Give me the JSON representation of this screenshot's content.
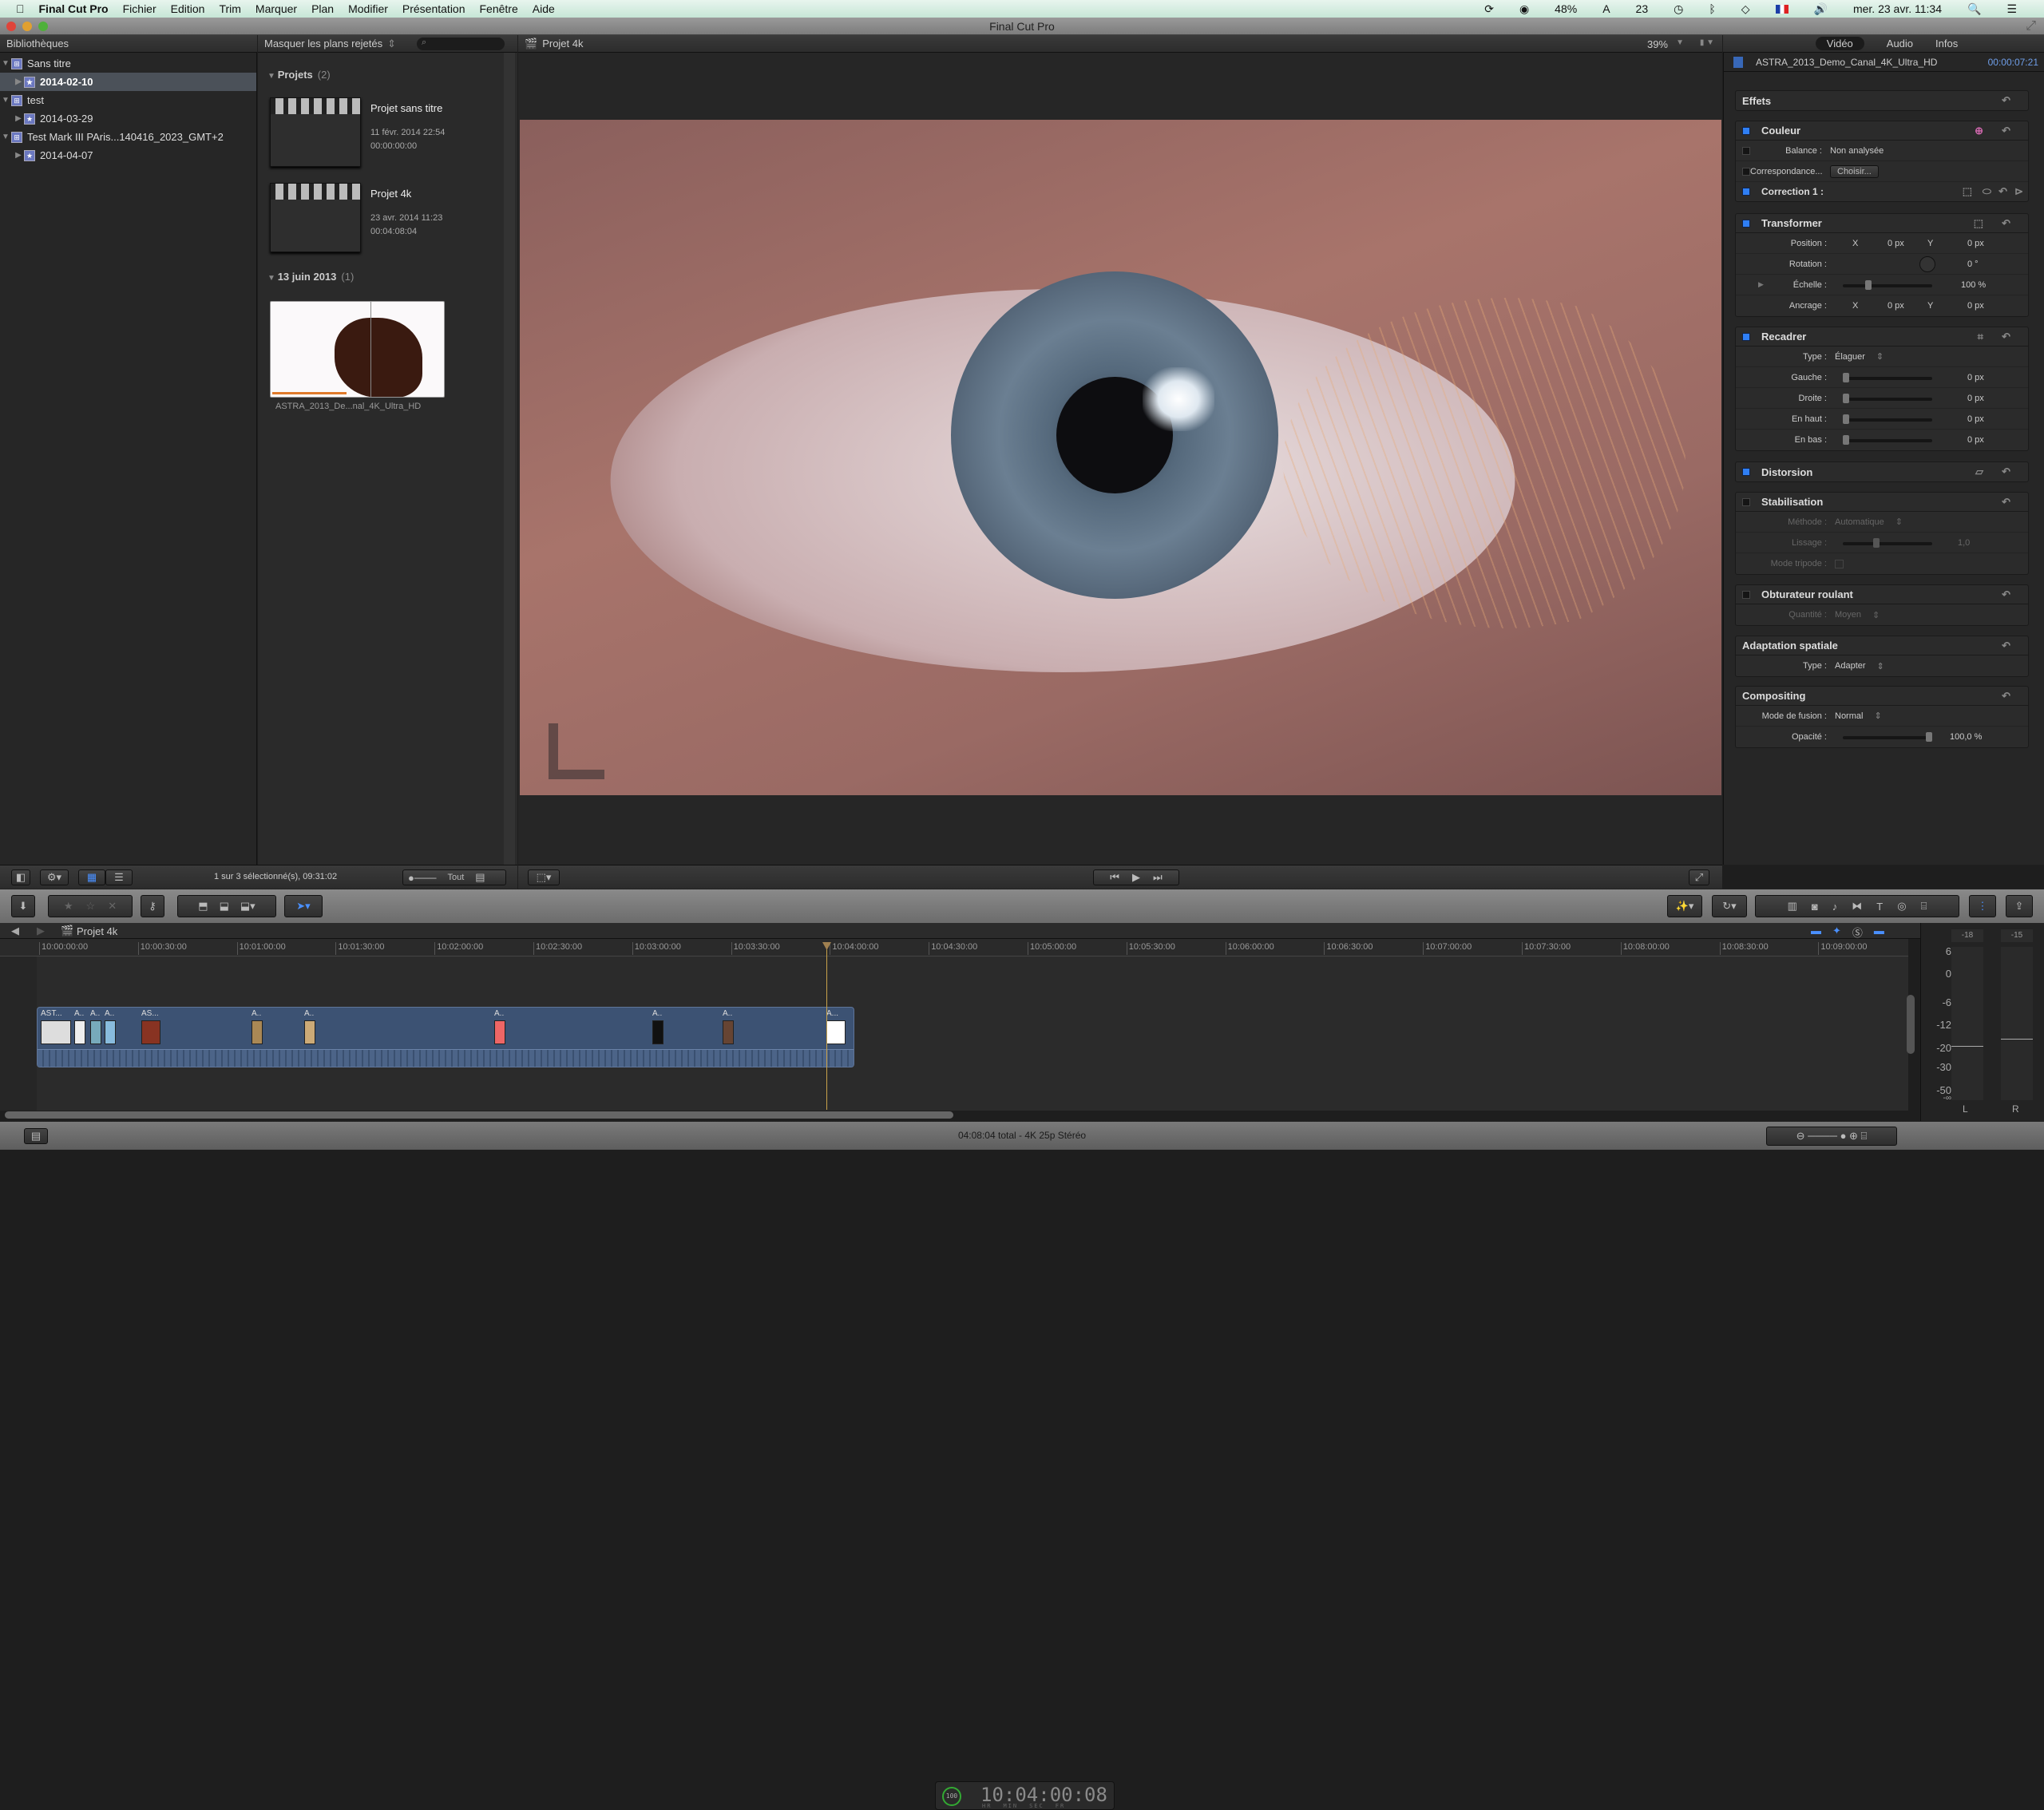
{
  "menubar": {
    "app": "Final Cut Pro",
    "items": [
      "Fichier",
      "Edition",
      "Trim",
      "Marquer",
      "Plan",
      "Modifier",
      "Présentation",
      "Fenêtre",
      "Aide"
    ],
    "battery": "48%",
    "adobe_count": "23",
    "datetime": "mer. 23 avr.  11:34"
  },
  "window": {
    "title": "Final Cut Pro"
  },
  "library": {
    "header": "Bibliothèques",
    "items": [
      {
        "label": "Sans titre",
        "level": 0,
        "type": "library"
      },
      {
        "label": "2014-02-10",
        "level": 1,
        "type": "event",
        "selected": true,
        "warning": true
      },
      {
        "label": "test",
        "level": 0,
        "type": "library"
      },
      {
        "label": "2014-03-29",
        "level": 1,
        "type": "event"
      },
      {
        "label": "Test Mark III PAris...140416_2023_GMT+2",
        "level": 0,
        "type": "library"
      },
      {
        "label": "2014-04-07",
        "level": 1,
        "type": "event",
        "warning": true
      }
    ]
  },
  "browser": {
    "filter": "Masquer les plans rejetés",
    "search_placeholder": "",
    "sections": [
      {
        "title": "Projets",
        "count": "(2)"
      },
      {
        "title": "13 juin 2013",
        "count": "(1)"
      }
    ],
    "projects": [
      {
        "name": "Projet sans titre",
        "date": "11 févr. 2014 22:54",
        "duration": "00:00:00:00"
      },
      {
        "name": "Projet 4k",
        "date": "23 avr. 2014 11:23",
        "duration": "00:04:08:04"
      }
    ],
    "clip": {
      "name": "ASTRA_2013_De...nal_4K_Ultra_HD"
    },
    "status": "1 sur 3 sélectionné(s), 09:31:02",
    "zoom_label": "Tout"
  },
  "viewer": {
    "title": "Projet 4k",
    "zoom": "39%"
  },
  "inspector": {
    "tabs": [
      "Vidéo",
      "Audio",
      "Infos"
    ],
    "active_tab": "Vidéo",
    "clip_name": "ASTRA_2013_Demo_Canal_4K_Ultra_HD",
    "clip_duration": "00:00:07:21",
    "effects": "Effets",
    "couleur": {
      "title": "Couleur",
      "balance_label": "Balance :",
      "balance_value": "Non analysée",
      "match_label": "Correspondance...",
      "match_button": "Choisir...",
      "correction": "Correction 1 :"
    },
    "transform": {
      "title": "Transformer",
      "position_label": "Position :",
      "x": "X",
      "y": "Y",
      "pos_x": "0 px",
      "pos_y": "0 px",
      "rotation_label": "Rotation :",
      "rotation": "0 °",
      "scale_label": "Échelle :",
      "scale": "100 %",
      "anchor_label": "Ancrage :",
      "anc_x": "0 px",
      "anc_y": "0 px"
    },
    "crop": {
      "title": "Recadrer",
      "type_label": "Type :",
      "type": "Élaguer",
      "left_label": "Gauche :",
      "left": "0 px",
      "right_label": "Droite :",
      "right": "0 px",
      "top_label": "En haut :",
      "top": "0 px",
      "bottom_label": "En bas :",
      "bottom": "0 px"
    },
    "distortion": {
      "title": "Distorsion"
    },
    "stabilization": {
      "title": "Stabilisation",
      "method_label": "Méthode :",
      "method": "Automatique",
      "smooth_label": "Lissage :",
      "smooth": "1,0",
      "tripod_label": "Mode tripode :"
    },
    "rolling": {
      "title": "Obturateur roulant",
      "amount_label": "Quantité :",
      "amount": "Moyen"
    },
    "spatial": {
      "title": "Adaptation spatiale",
      "type_label": "Type :",
      "type": "Adapter"
    },
    "compositing": {
      "title": "Compositing",
      "blend_label": "Mode de fusion :",
      "blend": "Normal",
      "opacity_label": "Opacité :",
      "opacity": "100,0 %",
      "opacity_fraction": 1.0
    }
  },
  "toolbar": {
    "timecode": "10:04:00:08",
    "tc_units": [
      "HR",
      "MIN",
      "SEC",
      "FR"
    ],
    "percent": "100"
  },
  "timeline": {
    "project": "Projet 4k",
    "ruler": [
      "10:00:00:00",
      "10:00:30:00",
      "10:01:00:00",
      "10:01:30:00",
      "10:02:00:00",
      "10:02:30:00",
      "10:03:00:00",
      "10:03:30:00",
      "10:04:00:00",
      "10:04:30:00",
      "10:05:00:00",
      "10:05:30:00",
      "10:06:00:00",
      "10:06:30:00",
      "10:07:00:00",
      "10:07:30:00",
      "10:08:00:00",
      "10:08:30:00",
      "10:09:00:00"
    ],
    "clip_labels": [
      "AST...",
      "A..",
      "A..",
      "A..",
      "AS...",
      "A..",
      "A..",
      "A..",
      "A..",
      "A..",
      "A..."
    ]
  },
  "meters": {
    "peaks": [
      "-18",
      "-15"
    ],
    "scale": [
      "6",
      "0",
      "-6",
      "-12",
      "-20",
      "-30",
      "-50",
      "-∞"
    ],
    "channels": [
      "L",
      "R"
    ]
  },
  "status": {
    "text": "04:08:04 total - 4K 25p Stéréo"
  },
  "colors": {
    "accent": "#2f7ff5",
    "clip": "#3c5273",
    "playhead": "#c9a24a",
    "timecode_blue": "#6f9ee8"
  }
}
